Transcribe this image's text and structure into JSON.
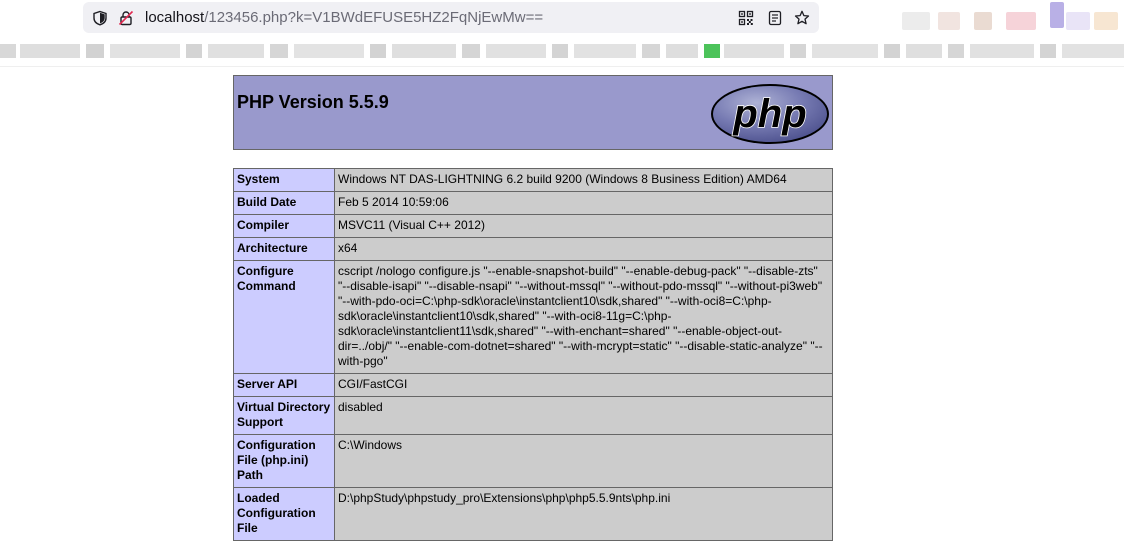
{
  "browser": {
    "url_host": "localhost",
    "url_rest": "/123456.php?k=V1BWdEFUSE5HZ2FqNjEwMw==",
    "icons": [
      "shield-icon",
      "insecure-lock-icon",
      "qr-code-icon",
      "reader-view-icon",
      "bookmark-star-icon"
    ]
  },
  "phpinfo": {
    "title": "PHP Version 5.5.9",
    "logo_text": "php",
    "rows": [
      {
        "key": "System",
        "value": "Windows NT DAS-LIGHTNING 6.2 build 9200 (Windows 8 Business Edition) AMD64"
      },
      {
        "key": "Build Date",
        "value": "Feb 5 2014 10:59:06"
      },
      {
        "key": "Compiler",
        "value": "MSVC11 (Visual C++ 2012)"
      },
      {
        "key": "Architecture",
        "value": "x64"
      },
      {
        "key": "Configure Command",
        "value": "cscript /nologo configure.js \"--enable-snapshot-build\" \"--enable-debug-pack\" \"--disable-zts\" \"--disable-isapi\" \"--disable-nsapi\" \"--without-mssql\" \"--without-pdo-mssql\" \"--without-pi3web\" \"--with-pdo-oci=C:\\php-sdk\\oracle\\instantclient10\\sdk,shared\" \"--with-oci8=C:\\php-sdk\\oracle\\instantclient10\\sdk,shared\" \"--with-oci8-11g=C:\\php-sdk\\oracle\\instantclient11\\sdk,shared\" \"--with-enchant=shared\" \"--enable-object-out-dir=../obj/\" \"--enable-com-dotnet=shared\" \"--with-mcrypt=static\" \"--disable-static-analyze\" \"--with-pgo\""
      },
      {
        "key": "Server API",
        "value": "CGI/FastCGI"
      },
      {
        "key": "Virtual Directory Support",
        "value": "disabled"
      },
      {
        "key": "Configuration File (php.ini) Path",
        "value": "C:\\Windows"
      },
      {
        "key": "Loaded Configuration File",
        "value": "D:\\phpStudy\\phpstudy_pro\\Extensions\\php\\php5.5.9nts\\php.ini"
      }
    ]
  },
  "colors": {
    "header_bg": "#9999cc",
    "key_bg": "#ccccff",
    "value_bg": "#cccccc",
    "border": "#666666"
  }
}
